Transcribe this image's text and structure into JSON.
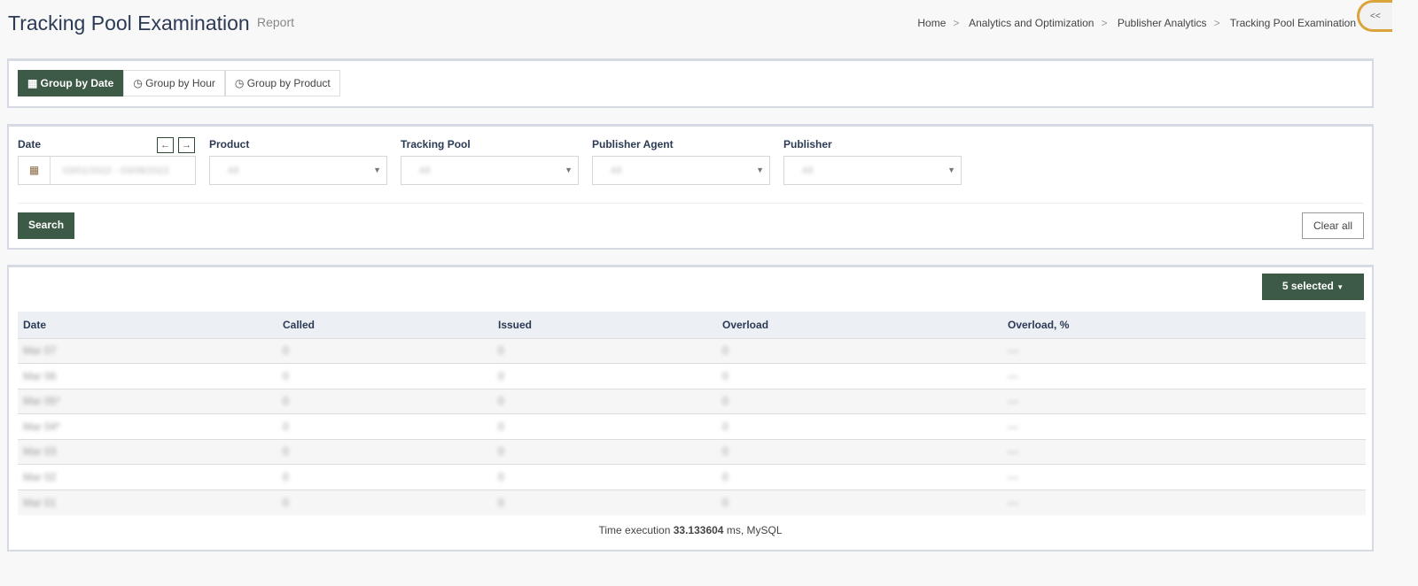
{
  "header": {
    "title": "Tracking Pool Examination",
    "subtitle": "Report",
    "breadcrumb": [
      "Home",
      "Analytics and Optimization",
      "Publisher Analytics",
      "Tracking Pool Examination"
    ],
    "toggle_label": "<<"
  },
  "group_tabs": [
    {
      "label": "Group by Date",
      "icon": "calendar-icon",
      "active": true
    },
    {
      "label": "Group by Hour",
      "icon": "clock-icon"
    },
    {
      "label": "Group by Product",
      "icon": "clock-icon"
    }
  ],
  "filters": {
    "date": {
      "label": "Date",
      "value": "03/01/2022 - 03/08/2022"
    },
    "product": {
      "label": "Product",
      "value": "All"
    },
    "tracking_pool": {
      "label": "Tracking Pool",
      "value": "All"
    },
    "publisher_agent": {
      "label": "Publisher Agent",
      "value": "All"
    },
    "publisher": {
      "label": "Publisher",
      "value": "All"
    },
    "search_label": "Search",
    "clear_label": "Clear all"
  },
  "table": {
    "columns_button": "5 selected",
    "headers": [
      "Date",
      "Called",
      "Issued",
      "Overload",
      "Overload, %"
    ],
    "rows": [
      [
        "Mar 07",
        "0",
        "0",
        "0",
        "—"
      ],
      [
        "Mar 06",
        "0",
        "0",
        "0",
        "—"
      ],
      [
        "Mar 05*",
        "0",
        "0",
        "0",
        "—"
      ],
      [
        "Mar 04*",
        "0",
        "0",
        "0",
        "—"
      ],
      [
        "Mar 03",
        "0",
        "0",
        "0",
        "—"
      ],
      [
        "Mar 02",
        "0",
        "0",
        "0",
        "—"
      ],
      [
        "Mar 01",
        "0",
        "0",
        "0",
        "—"
      ]
    ]
  },
  "footer": {
    "prefix": "Time execution ",
    "value": "33.133604",
    "suffix": " ms, MySQL"
  },
  "colors": {
    "accent": "#3c5a45",
    "toggle": "#d9a43a"
  }
}
